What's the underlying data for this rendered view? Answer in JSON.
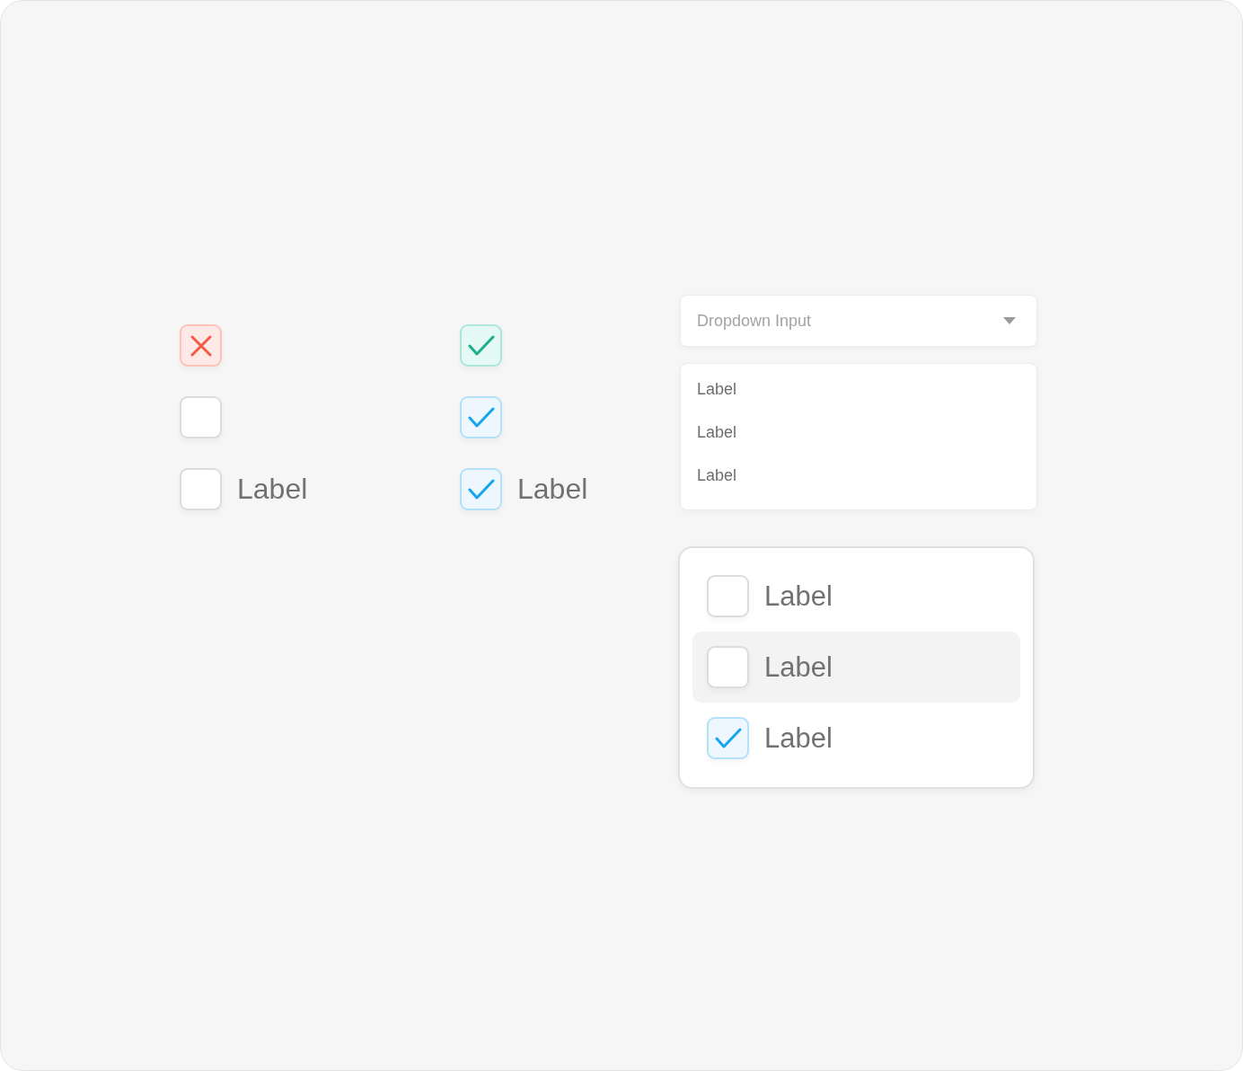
{
  "checkboxes": [
    {
      "kind": "error",
      "checked": true
    },
    {
      "kind": "success",
      "checked": true
    },
    {
      "kind": "default",
      "checked": false
    },
    {
      "kind": "default",
      "checked": true
    },
    {
      "kind": "default",
      "checked": false,
      "label": "Label"
    },
    {
      "kind": "default",
      "checked": true,
      "label": "Label"
    }
  ],
  "dropdown": {
    "placeholder": "Dropdown Input",
    "options": [
      "Label",
      "Label",
      "Label"
    ]
  },
  "checklist": [
    {
      "kind": "plain",
      "label": "Label",
      "checked": false
    },
    {
      "kind": "highlighted",
      "label": "Label",
      "checked": false
    },
    {
      "kind": "plain",
      "label": "Label",
      "checked": true
    }
  ]
}
